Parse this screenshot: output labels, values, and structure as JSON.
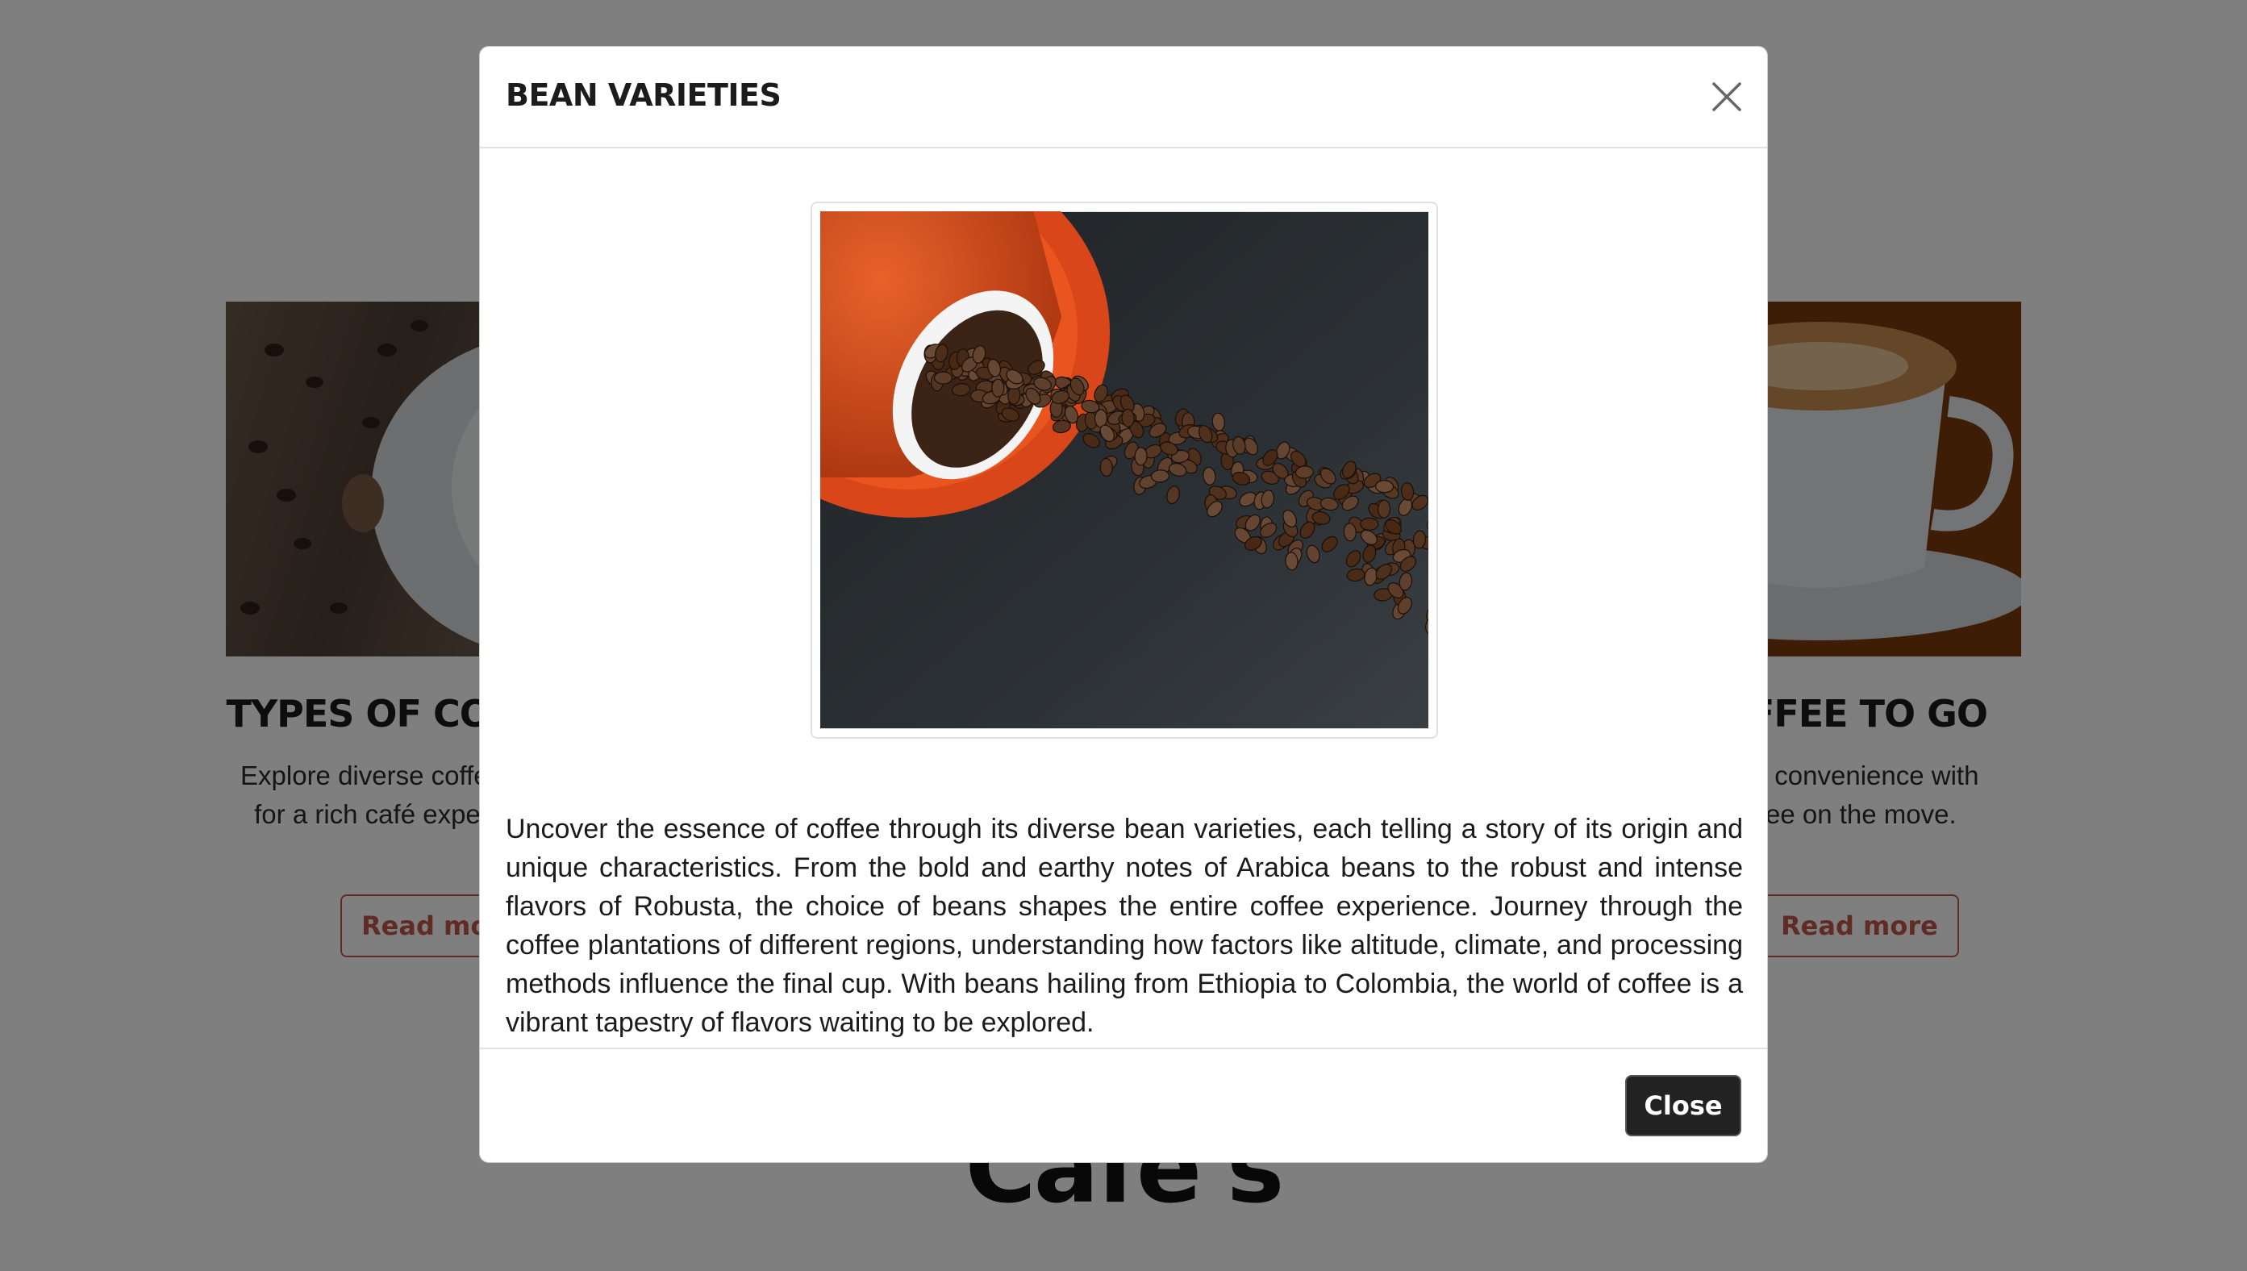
{
  "background": {
    "cards": [
      {
        "title": "TYPES OF COFFEE",
        "text": "Explore diverse coffee types for a rich café experience.",
        "button": "Read more"
      },
      {
        "title": "COFFEE TO GO",
        "text": "Enjoy convenience with coffee on the move.",
        "button": "Read more"
      }
    ],
    "bottom_heading": "Café's"
  },
  "modal": {
    "title": "BEAN VARIETIES",
    "close_icon": "close-icon",
    "image_alt": "Coffee beans spilling from an orange cup",
    "body": "Uncover the essence of coffee through its diverse bean varieties, each telling a story of its origin and unique characteristics. From the bold and earthy notes of Arabica beans to the robust and intense flavors of Robusta, the choice of beans shapes the entire coffee experience. Journey through the coffee plantations of different regions, understanding how factors like altitude, climate, and processing methods influence the final cup. With beans hailing from Ethiopia to Colombia, the world of coffee is a vibrant tapestry of flavors waiting to be explored.",
    "close_button": "Close"
  },
  "colors": {
    "accent": "#c0564b",
    "button_dark": "#222222",
    "backdrop": "rgba(0,0,0,0.5)"
  }
}
